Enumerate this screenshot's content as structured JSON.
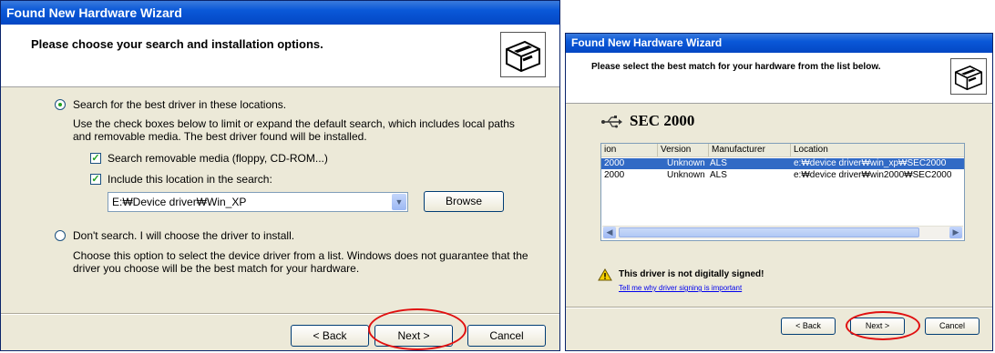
{
  "left_window": {
    "title": "Found New Hardware Wizard",
    "heading": "Please choose your search and installation options.",
    "option_search": "Search for the best driver in these locations.",
    "search_desc": "Use the check boxes below to limit or expand the default search, which includes local paths and removable media. The best driver found will be installed.",
    "check_removable": "Search removable media (floppy, CD-ROM...)",
    "check_location": "Include this location in the search:",
    "location_value": "E:₩Device driver₩Win_XP",
    "browse_label": "Browse",
    "option_dont_search": "Don't search. I will choose the driver to install.",
    "dont_search_desc": "Choose this option to select the device driver from a list.  Windows does not guarantee that the driver you choose will be the best match for your hardware.",
    "back_label": "< Back",
    "next_label": "Next >",
    "cancel_label": "Cancel"
  },
  "right_window": {
    "title": "Found New Hardware Wizard",
    "heading": "Please select the best match for your hardware from the list below.",
    "device_name": "SEC 2000",
    "columns": [
      "ion",
      "Version",
      "Manufacturer",
      "Location"
    ],
    "rows": [
      {
        "name": "2000",
        "version": "Unknown",
        "manufacturer": "ALS",
        "location": "e:₩device driver₩win_xp₩SEC2000",
        "selected": true
      },
      {
        "name": "2000",
        "version": "Unknown",
        "manufacturer": "ALS",
        "location": "e:₩device driver₩win2000₩SEC2000",
        "selected": false
      }
    ],
    "warning": "This driver is not digitally signed!",
    "warning_link": "Tell me why driver signing is important",
    "back_label": "< Back",
    "next_label": "Next >",
    "cancel_label": "Cancel"
  },
  "colors": {
    "title_bar": "#0a58d8",
    "highlight_ellipse": "#e01010",
    "selection": "#316ac5",
    "link": "#0000ee"
  },
  "icons": [
    "hardware-wizard-icon",
    "usb-icon",
    "warning-icon"
  ]
}
